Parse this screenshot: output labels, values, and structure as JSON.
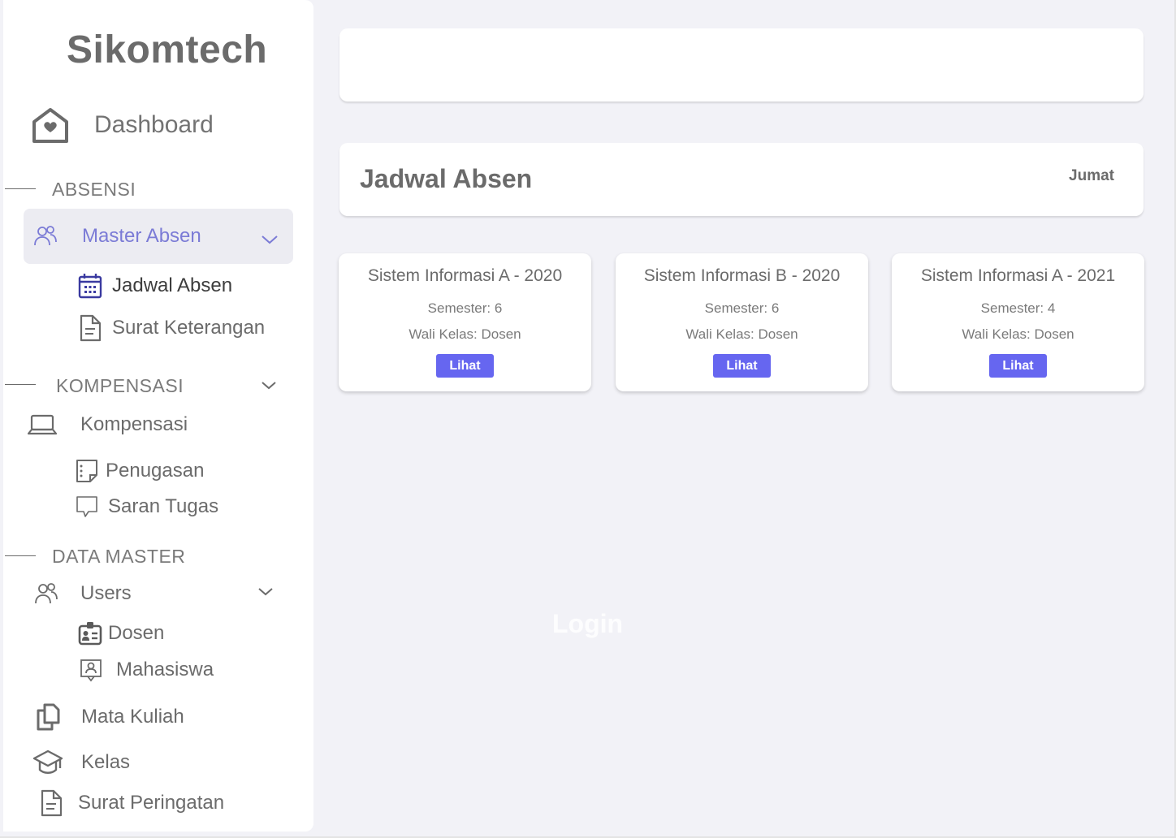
{
  "brand": "Sikomtech",
  "sidebar": {
    "dashboard": "Dashboard",
    "absensi": {
      "section": "ABSENSI",
      "master": "Master Absen",
      "jadwal": "Jadwal Absen",
      "surat": "Surat Keterangan"
    },
    "kompensasi": {
      "section": "KOMPENSASI",
      "main": "Kompensasi",
      "penugasan": "Penugasan",
      "saran": "Saran Tugas"
    },
    "datamaster": {
      "section": "DATA MASTER",
      "users": "Users",
      "dosen": "Dosen",
      "mahasiswa": "Mahasiswa",
      "matkul": "Mata Kuliah",
      "kelas": "Kelas",
      "peringatan": "Surat Peringatan"
    }
  },
  "header": {
    "title": "Jadwal Absen",
    "day": "Jumat"
  },
  "cards": [
    {
      "title": "Sistem Informasi A - 2020",
      "semester": "Semester: 6",
      "wali": "Wali Kelas: Dosen",
      "button": "Lihat"
    },
    {
      "title": "Sistem Informasi B - 2020",
      "semester": "Semester: 6",
      "wali": "Wali Kelas: Dosen",
      "button": "Lihat"
    },
    {
      "title": "Sistem Informasi A - 2021",
      "semester": "Semester: 4",
      "wali": "Wali Kelas: Dosen",
      "button": "Lihat"
    }
  ],
  "ghost_text": "Login",
  "colors": {
    "accent": "#6666f0",
    "active_text": "#7b7bd6",
    "active_bg": "#ececf2",
    "calendar_icon": "#3a3aa0"
  }
}
